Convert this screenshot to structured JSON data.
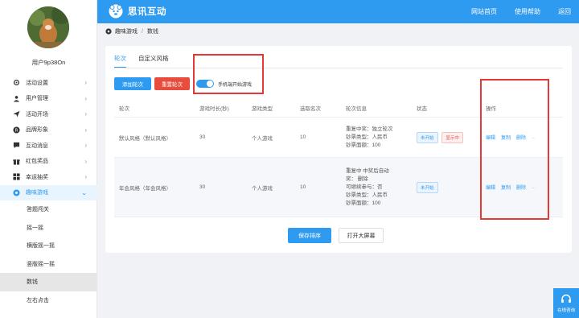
{
  "topbar": {
    "brand": "思讯互动",
    "links": [
      "网站首页",
      "使用帮助",
      "返回"
    ]
  },
  "user": {
    "name": "用户9p38On"
  },
  "sidebar": {
    "items": [
      {
        "label": "活动设置",
        "icon": "gear-icon"
      },
      {
        "label": "用户管理",
        "icon": "user-icon"
      },
      {
        "label": "活动开场",
        "icon": "send-icon"
      },
      {
        "label": "品牌形象",
        "icon": "brand-icon"
      },
      {
        "label": "互动消息",
        "icon": "message-icon"
      },
      {
        "label": "红包奖品",
        "icon": "gift-icon"
      },
      {
        "label": "幸运抽奖",
        "icon": "grid-icon"
      },
      {
        "label": "趣味游戏",
        "icon": "game-icon"
      }
    ],
    "sub_items": [
      "答题闯关",
      "摇一摇",
      "横版摇一摇",
      "竖版摇一摇",
      "数钱",
      "左右点击"
    ]
  },
  "breadcrumb": {
    "parent": "趣味游戏",
    "sep": "/",
    "current": "数钱"
  },
  "tabs": [
    "轮次",
    "自定义风格"
  ],
  "actions": {
    "add": "添加轮次",
    "reset": "重置轮次",
    "toggle_label": "手机端开始游戏",
    "toggle_on": true
  },
  "table": {
    "headers": [
      "轮次",
      "游戏时长(秒)",
      "游戏类型",
      "选取名次",
      "轮次信息",
      "状态",
      "操作"
    ],
    "rows": [
      {
        "name": "默认风格（默认风格）",
        "duration": "30",
        "type": "个人游戏",
        "rank": "10",
        "info": [
          "重复中奖：独立轮次",
          "钞票类型：人民币",
          "钞票面额：100"
        ],
        "status": [
          "未开始",
          "显示中"
        ],
        "ops": [
          "编辑",
          "复制",
          "删除",
          "..."
        ]
      },
      {
        "name": "年会风格（年会风格）",
        "duration": "30",
        "type": "个人游戏",
        "rank": "10",
        "info": [
          "重复中    中奖后自动",
          "奖：      删除",
          "可继续参与：否",
          "钞票类型：人民币",
          "钞票面额：100"
        ],
        "status": [
          "未开始"
        ],
        "ops": [
          "编辑",
          "复制",
          "删除",
          "..."
        ]
      }
    ]
  },
  "footer_buttons": {
    "save": "保存排序",
    "open": "打开大屏幕"
  },
  "chat": {
    "label": "在线咨询"
  },
  "colors": {
    "primary": "#2e9bf0",
    "danger": "#e74c3c",
    "highlight": "#e53935"
  }
}
